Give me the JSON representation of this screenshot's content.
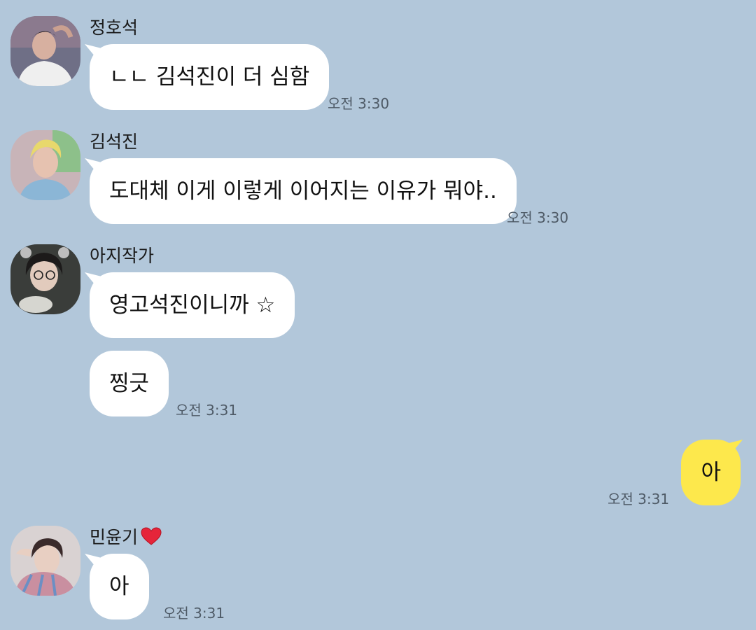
{
  "messages": [
    {
      "sender": "정호석",
      "text": "ㄴㄴ 김석진이 더 심함",
      "time": "오전 3:30"
    },
    {
      "sender": "김석진",
      "text": "도대체 이게 이렇게 이어지는 이유가 뭐야..",
      "time": "오전 3:30"
    },
    {
      "sender": "아지작가",
      "texts": [
        "영고석진이니까 ☆",
        "찡긋"
      ],
      "time": "오전 3:31"
    },
    {
      "sender": "me",
      "text": "아",
      "time": "오전 3:31"
    },
    {
      "sender": "민윤기",
      "text": "아",
      "time": "오전 3:31",
      "sender_icon": "heart-icon"
    }
  ],
  "colors": {
    "background": "#b2c7da",
    "incoming_bubble": "#ffffff",
    "outgoing_bubble": "#fde84c",
    "time_text": "#4e5a66"
  }
}
